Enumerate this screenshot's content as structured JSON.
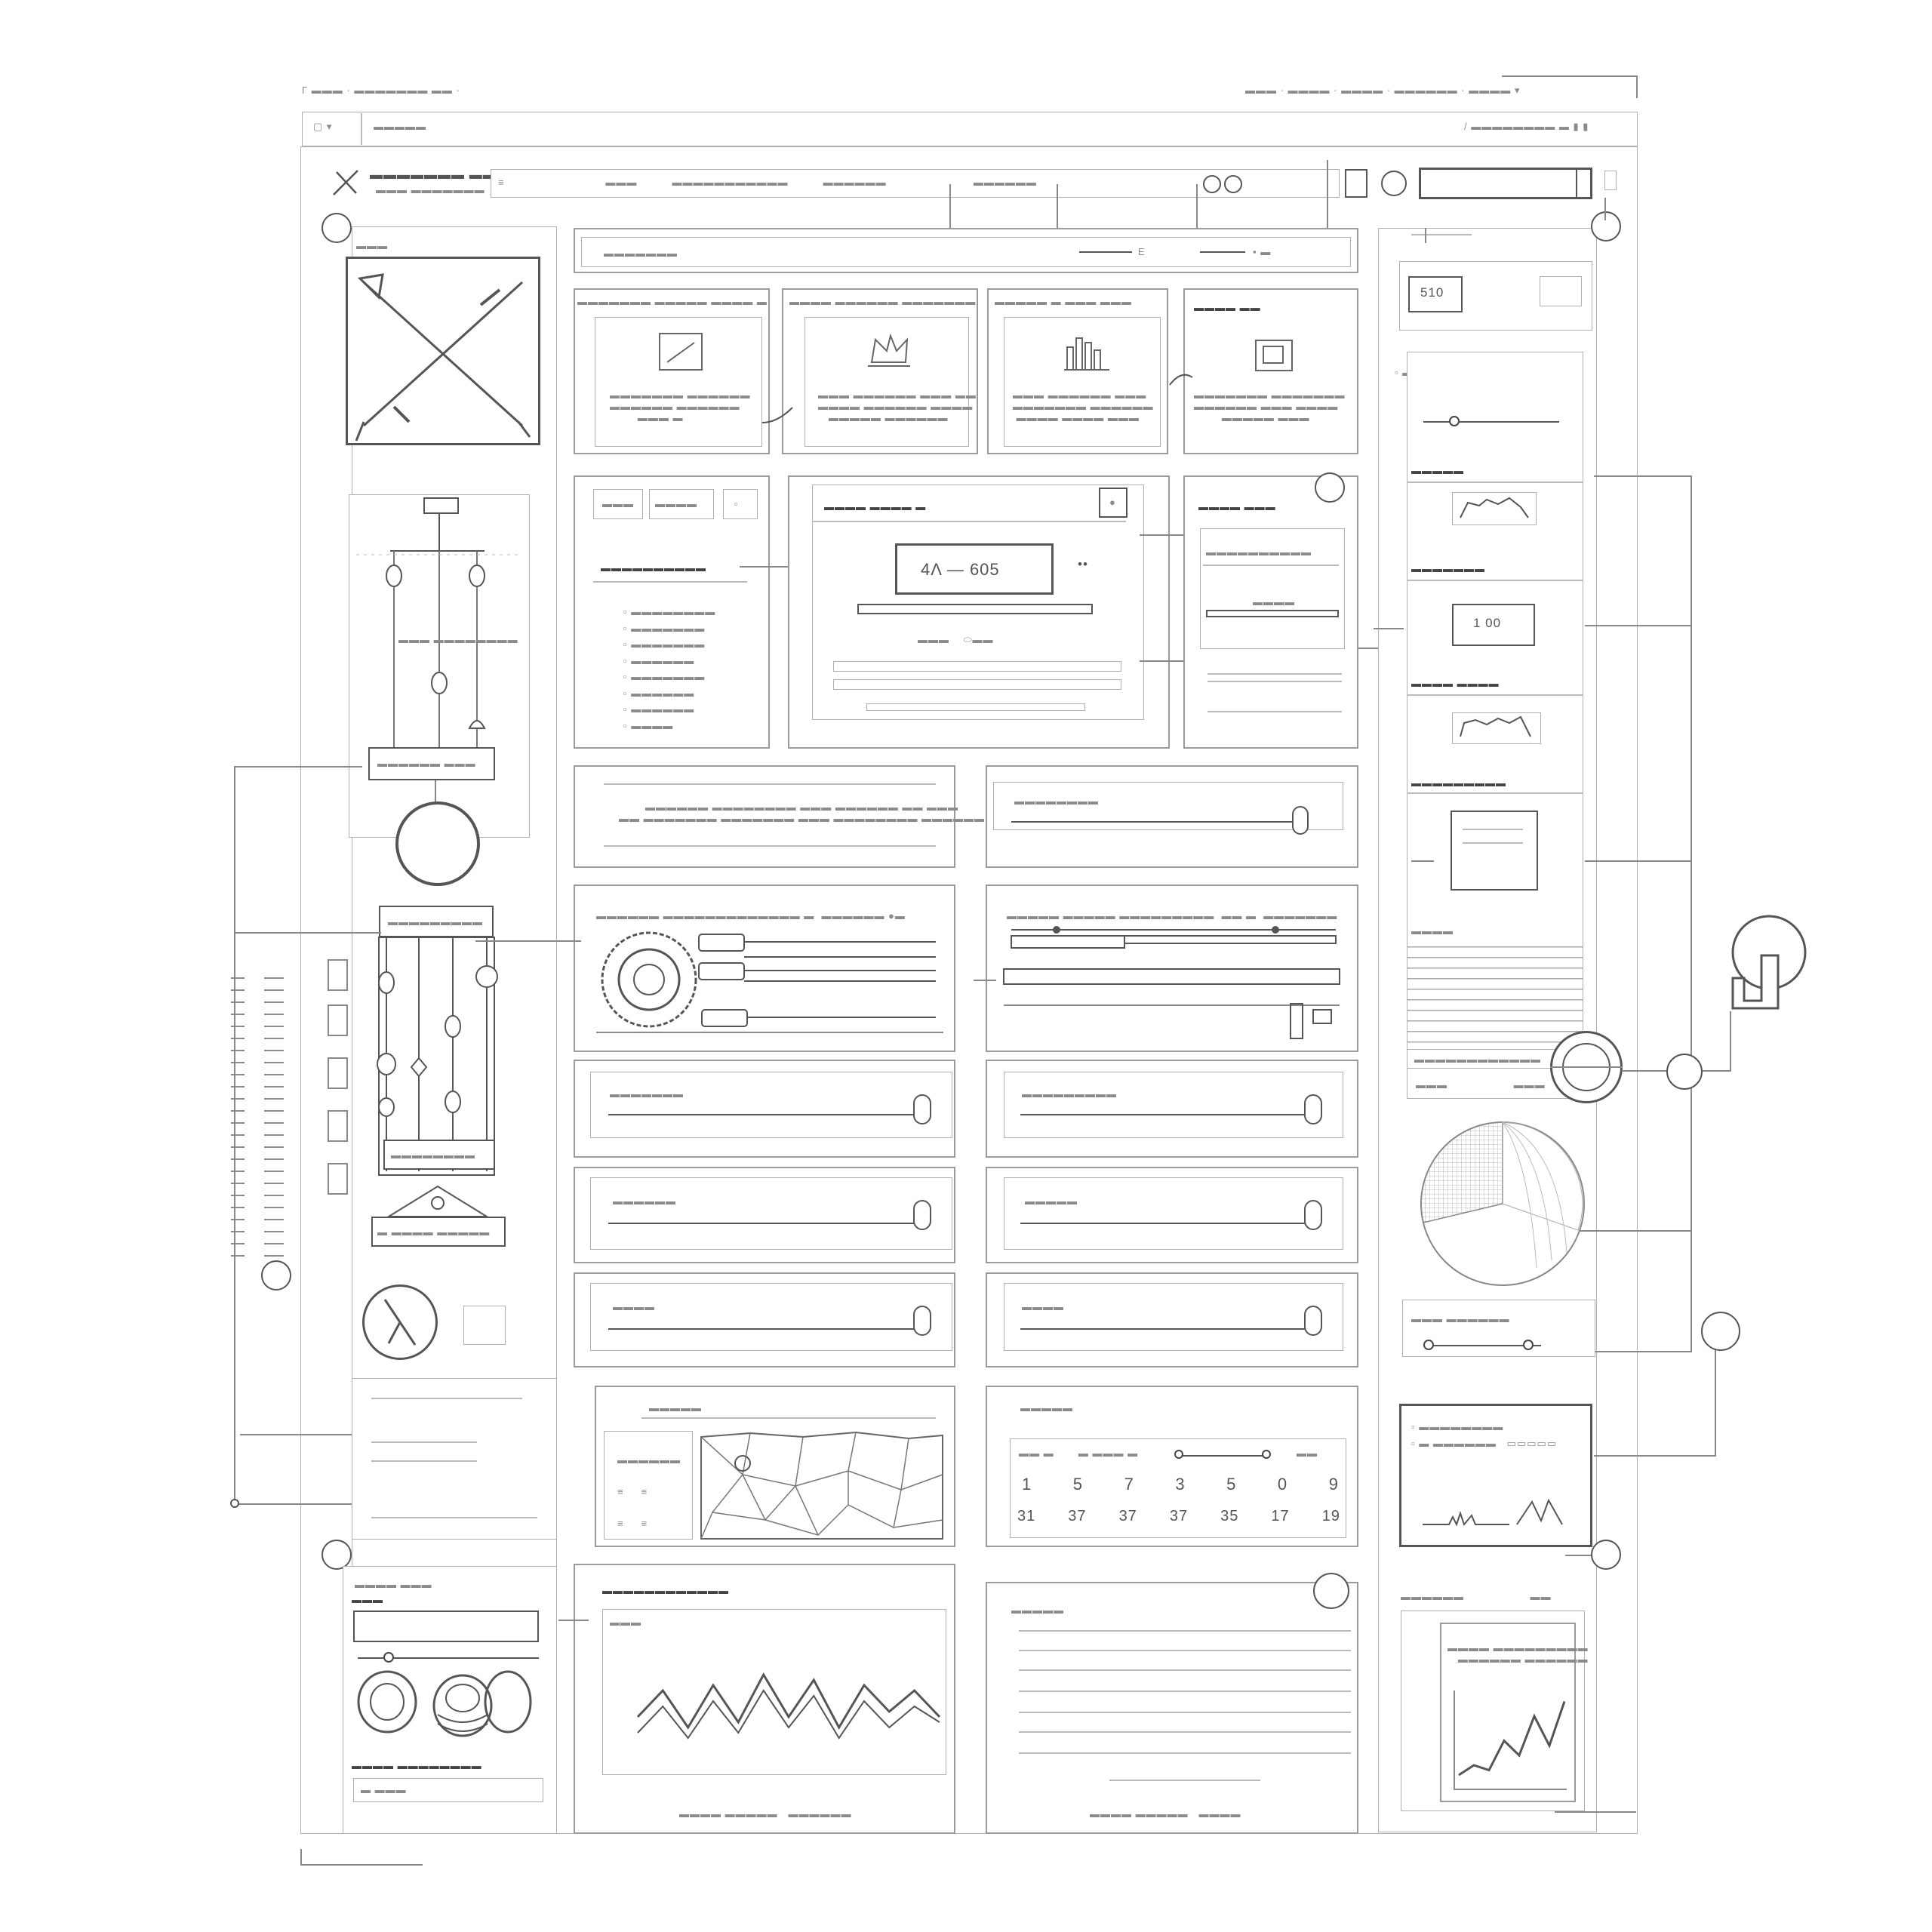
{
  "browser": {
    "breadcrumb_left": "Γ",
    "breadcrumb_mid": "· ·",
    "nav_items": [
      ".",
      ".",
      ".",
      "."
    ]
  },
  "header": {
    "search_button_icon": "search-icon",
    "settings_icon": "gear-icon",
    "menu_icon": "menu-icon"
  },
  "stats_row": {
    "cards": [
      {
        "icon": "chart-icon"
      },
      {
        "icon": "crown-icon"
      },
      {
        "icon": "bar-chart-icon"
      },
      {
        "icon": "calendar-icon"
      }
    ]
  },
  "center_card": {
    "display_value": "4Λ — 605"
  },
  "calendar": {
    "row1": [
      "1",
      "5",
      "7",
      "3",
      "5",
      "0",
      "9"
    ],
    "row2": [
      "31",
      "37",
      "37",
      "37",
      "35",
      "17",
      "19"
    ]
  },
  "right_panel": {
    "card_value": "510",
    "counter_value": "1 00"
  },
  "chart_data": {
    "type": "line",
    "series": [
      {
        "values": [
          30,
          55,
          20,
          60,
          25,
          70,
          30,
          65,
          20,
          60,
          35,
          55,
          30
        ]
      },
      {
        "values": [
          15,
          40,
          10,
          45,
          15,
          55,
          20,
          50,
          10,
          45,
          20,
          40,
          25
        ]
      }
    ],
    "ylim": [
      0,
      100
    ],
    "grid": false
  },
  "mini_chart_data": {
    "type": "line",
    "series": [
      {
        "values": [
          10,
          20,
          15,
          45,
          30,
          70,
          40,
          85
        ]
      }
    ],
    "ylim": [
      0,
      100
    ]
  }
}
